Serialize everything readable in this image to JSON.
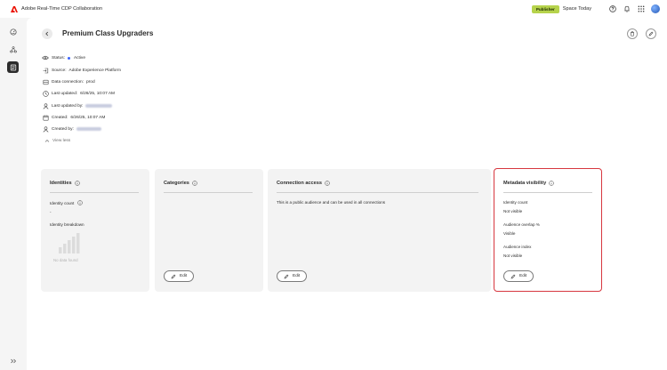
{
  "app": {
    "title": "Adobe Real-Time CDP Collaboration",
    "badge": "Publisher",
    "space": "Space Today"
  },
  "topbar_icons": [
    "help-icon",
    "bell-icon",
    "apps-grid-icon",
    "avatar"
  ],
  "rail": {
    "items": [
      {
        "name": "home-icon",
        "active": false
      },
      {
        "name": "connections-icon",
        "active": false
      },
      {
        "name": "audiences-icon",
        "active": true
      }
    ],
    "expand_icon": "expand-double-chevron-icon"
  },
  "page": {
    "title": "Premium Class Upgraders",
    "actions": [
      "trash-icon",
      "edit-pencil-icon"
    ]
  },
  "details": {
    "status_label": "Status:",
    "status_value": "Active",
    "source_label": "Source:",
    "source_value": "Adobe Experience Platform",
    "connection_label": "Data connection:",
    "connection_value": "prod",
    "last_updated_label": "Last updated:",
    "last_updated_value": "6/26/25, 10:07 AM",
    "last_updated_by_label": "Last updated by:",
    "created_label": "Created:",
    "created_value": "6/26/25, 10:07 AM",
    "created_by_label": "Created by:",
    "view_less": "View less"
  },
  "cards": {
    "identities": {
      "title": "Identities",
      "count_label": "Identity count",
      "count_value": "-",
      "breakdown_label": "Identity breakdown",
      "no_data": "No data found"
    },
    "categories": {
      "title": "Categories",
      "edit": "Edit"
    },
    "connection_access": {
      "title": "Connection access",
      "description": "This is a public audience and can be used in all connections",
      "edit": "Edit"
    },
    "metadata_visibility": {
      "title": "Metadata visibility",
      "items": [
        {
          "label": "Identity count",
          "value": "Not visible"
        },
        {
          "label": "Audience overlap %",
          "value": "Visible"
        },
        {
          "label": "Audience index",
          "value": "Not visible"
        }
      ],
      "edit": "Edit"
    }
  },
  "colors": {
    "accent_blue": "#3b63fb",
    "badge_green": "#b6d34c",
    "highlight_red": "#d7373f"
  }
}
